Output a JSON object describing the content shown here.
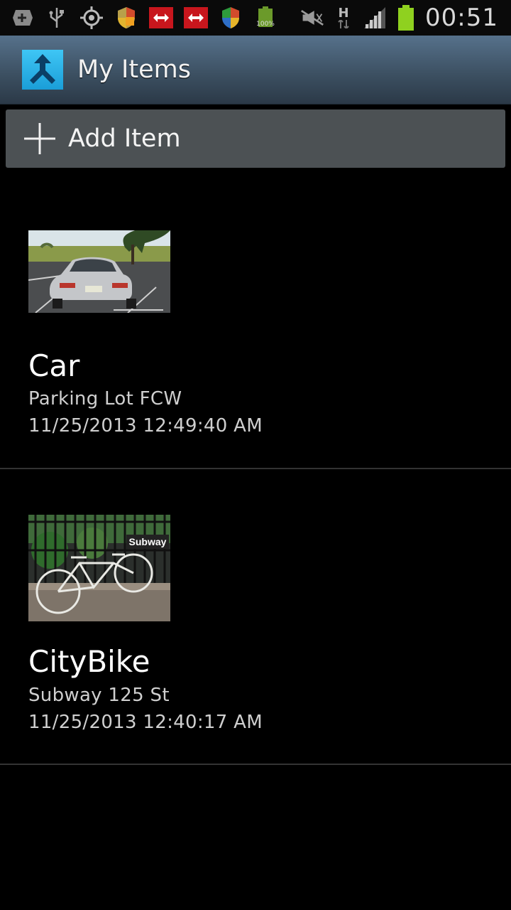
{
  "status_bar": {
    "battery_percent_label": "100%",
    "network_type": "H",
    "time": "00:51",
    "icons": [
      "add-notify-icon",
      "usb-icon",
      "gps-icon",
      "shield-warning-icon",
      "transit-icon",
      "transit-icon",
      "shield-icon",
      "battery-small-icon",
      "mute-icon",
      "network-h-icon",
      "signal-icon",
      "battery-icon"
    ]
  },
  "action_bar": {
    "title": "My Items",
    "app_icon": "merge-arrow-icon"
  },
  "add_item": {
    "label": "Add Item",
    "icon": "plus-icon"
  },
  "items": [
    {
      "title": "Car",
      "location": "Parking Lot FCW",
      "timestamp": "11/25/2013 12:49:40 AM",
      "thumbnail": "car-photo"
    },
    {
      "title": "CityBike",
      "location": "Subway 125 St",
      "timestamp": "11/25/2013 12:40:17 AM",
      "thumbnail": "bike-photo",
      "thumbnail_sign": "Subway"
    }
  ],
  "colors": {
    "action_bar_top": "#56718b",
    "action_bar_bottom": "#2b3947",
    "button_bg": "#4c5154",
    "app_icon_blue": "#2ab0e6"
  }
}
